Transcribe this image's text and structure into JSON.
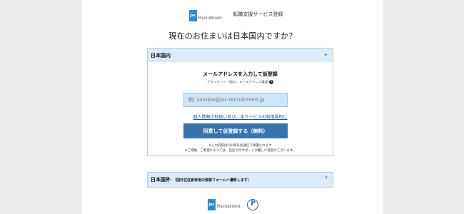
{
  "header": {
    "logo_mark": "jac",
    "logo_text": "Recruitment",
    "title": "転職支援サービス登録"
  },
  "question": "現在のお住まいは日本国内ですか？",
  "japan_section": {
    "header_label": "日本国内",
    "chevron_icon": "chevron-down-icon",
    "email_title": "メールアドレスを入力して仮登録",
    "email_note": "プライベート（個人）メールアドレス推奨",
    "help_icon": "?",
    "email_placeholder": "例: sample@jac-recruitment.jp",
    "privacy_link": "個人情報の取扱い及び、本サービスの利用規約に",
    "submit_label": "同意して仮登録する（無料）",
    "fine_print_1": "※入力内容はSSL暗号化通信で保護されます",
    "fine_print_2": "※ご経験、ご希望によっては、当社でのサポートが難しい場合がございます。"
  },
  "abroad_section": {
    "header_label": "日本国外",
    "sub_label": "（国外在住者専用の登録フォームへ遷移します）",
    "chevron_icon": "chevron-right-icon"
  },
  "footer": {
    "logo_mark": "jac",
    "logo_text": "Recruitment",
    "privacy_mark": "P"
  },
  "colors": {
    "accent": "#3a72ad",
    "section_header_bg": "#dcebf7",
    "input_bg": "#cfe4f5",
    "link": "#1f4fa0"
  }
}
